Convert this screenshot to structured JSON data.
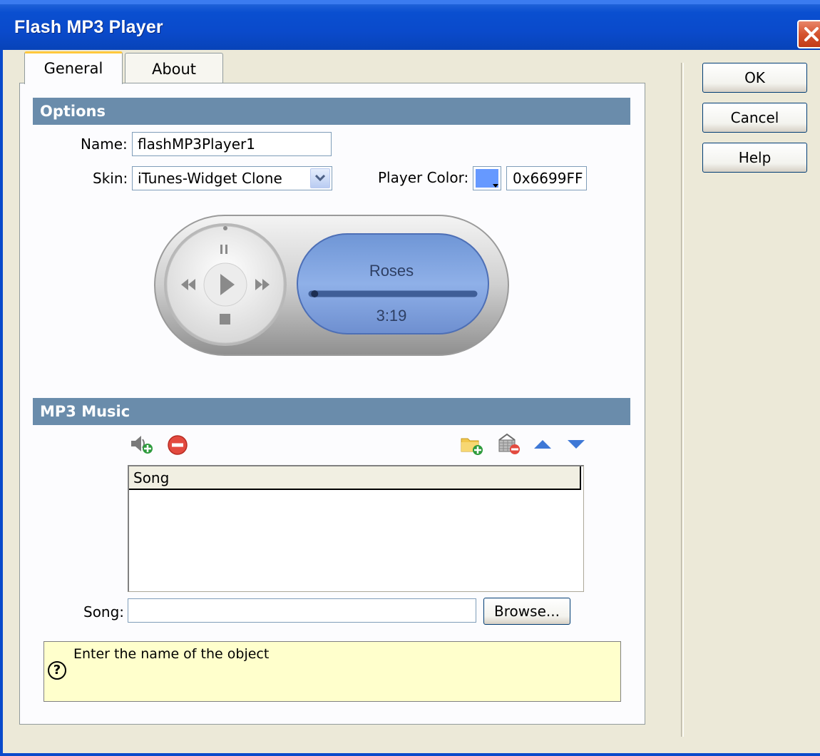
{
  "window": {
    "title": "Flash MP3 Player"
  },
  "tabs": [
    {
      "label": "General",
      "active": true
    },
    {
      "label": "About",
      "active": false
    }
  ],
  "options": {
    "header": "Options",
    "name_label": "Name:",
    "name_value": "flashMP3Player1",
    "skin_label": "Skin:",
    "skin_value": "iTunes-Widget Clone",
    "player_color_label": "Player Color:",
    "player_color_value": "0x6699FF",
    "player_color_hex": "#6699FF"
  },
  "preview": {
    "song_title": "Roses",
    "time": "3:19",
    "progress": 0.01
  },
  "music": {
    "header": "MP3 Music",
    "toolbar_icons": [
      "add-song-icon",
      "remove-icon",
      "add-folder-icon",
      "remove-folder-icon",
      "move-up-icon",
      "move-down-icon"
    ],
    "list_header": "Song",
    "songs": [],
    "song_label": "Song:",
    "song_value": "",
    "browse_label": "Browse..."
  },
  "hint": {
    "text": "Enter the name of the object"
  },
  "buttons": {
    "ok": "OK",
    "cancel": "Cancel",
    "help": "Help"
  }
}
